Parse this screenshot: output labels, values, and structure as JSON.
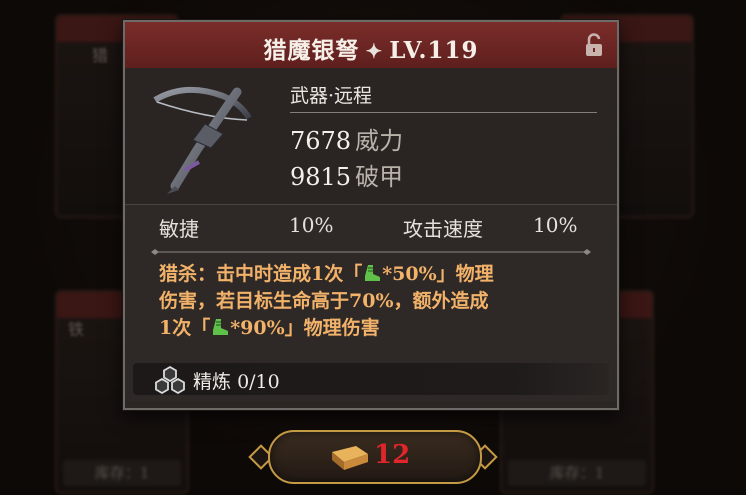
{
  "item": {
    "name": "猎魔银弩",
    "level": "LV.119",
    "category": "武器·远程",
    "stats": [
      {
        "value": "7678",
        "label": "威力"
      },
      {
        "value": "9815",
        "label": "破甲"
      }
    ],
    "attributes": [
      {
        "label": "敏捷",
        "value": "10%"
      },
      {
        "label": "攻击速度",
        "value": "10%"
      }
    ],
    "skill": {
      "line1_a": "猎杀：击中时造成1次「",
      "line1_b": "*50%」物理",
      "line2": "伤害，若目标生命高于70%，额外造成",
      "line3_a": "1次「",
      "line3_b": "*90%」物理伤害"
    },
    "refine": {
      "label": "精炼",
      "value": "0/10"
    }
  },
  "cost": {
    "amount": "12"
  },
  "background": {
    "slot_labels": [
      "库存：1",
      "库存：1",
      "库存"
    ],
    "side_titles": [
      "猎",
      "铁"
    ]
  },
  "colors": {
    "title_bar": "#6e2624",
    "skill_text": "#f2b26a",
    "cost_text": "#e0262a",
    "frame_gold": "#c59a44"
  },
  "icons": [
    "lock-icon",
    "crossbow-icon",
    "four-point-star-icon",
    "boot-icon",
    "refine-hex-icon",
    "gold-ingot-icon"
  ]
}
